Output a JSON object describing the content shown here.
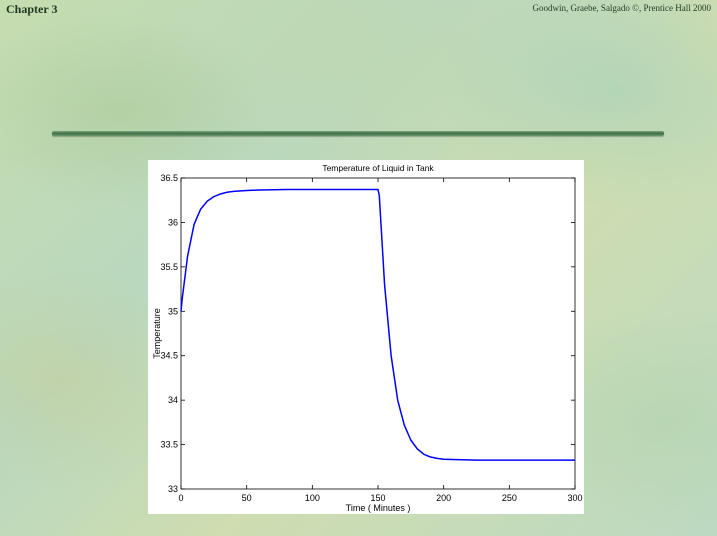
{
  "header": {
    "chapter": "Chapter 3",
    "credit": "Goodwin, Graebe, Salgado ©, Prentice Hall 2000"
  },
  "chart_data": {
    "type": "line",
    "title": "Temperature of Liquid in Tank",
    "xlabel": "Time ( Minutes )",
    "ylabel": "Temperature",
    "xlim": [
      0,
      300
    ],
    "ylim": [
      33,
      36.5
    ],
    "xticks": [
      "0",
      "50",
      "100",
      "150",
      "200",
      "250",
      "300"
    ],
    "yticks": [
      "33",
      "33.5",
      "34",
      "34.5",
      "35",
      "35.5",
      "36",
      "36.5"
    ],
    "grid": false,
    "series_color": "#0000ff",
    "series": [
      {
        "x": [
          0,
          1,
          5,
          10,
          15,
          20,
          25,
          30,
          35,
          40,
          50,
          60,
          80,
          100,
          120,
          150,
          151,
          155,
          160,
          165,
          170,
          175,
          180,
          185,
          190,
          195,
          200,
          210,
          225,
          250,
          275,
          300
        ],
        "y": [
          35.0,
          35.15,
          35.62,
          35.98,
          36.15,
          36.24,
          36.29,
          36.32,
          36.34,
          36.35,
          36.36,
          36.365,
          36.37,
          36.37,
          36.37,
          36.37,
          36.3,
          35.3,
          34.5,
          34.0,
          33.72,
          33.55,
          33.45,
          33.39,
          33.36,
          33.345,
          33.335,
          33.33,
          33.325,
          33.325,
          33.325,
          33.325
        ]
      }
    ]
  }
}
